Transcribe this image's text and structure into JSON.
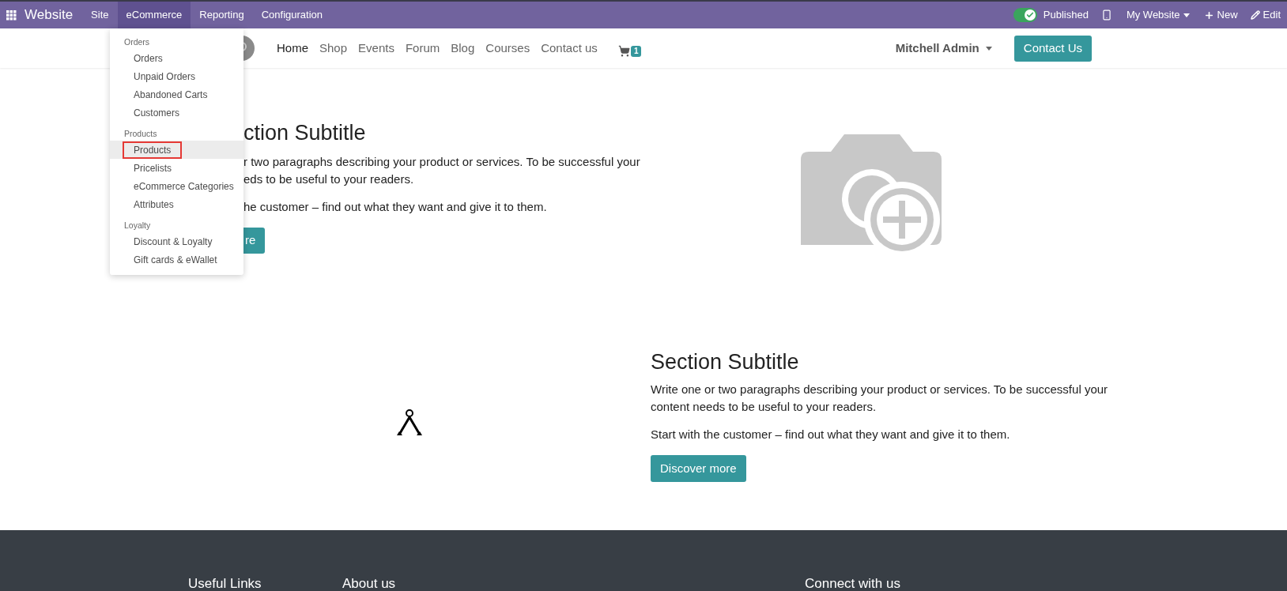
{
  "top_bar": {
    "app_name": "Website",
    "menus": [
      {
        "label": "Site",
        "selected": false
      },
      {
        "label": "eCommerce",
        "selected": true
      },
      {
        "label": "Reporting",
        "selected": false
      },
      {
        "label": "Configuration",
        "selected": false
      }
    ],
    "published": {
      "label": "Published",
      "on": true
    },
    "website_switcher": "My Website",
    "new_button": "New",
    "edit_button": "Edit"
  },
  "dropdown": {
    "groups": [
      {
        "title": "Orders",
        "items": [
          {
            "label": "Orders",
            "selected": false
          },
          {
            "label": "Unpaid Orders",
            "selected": false
          },
          {
            "label": "Abandoned Carts",
            "selected": false
          },
          {
            "label": "Customers",
            "selected": false
          }
        ]
      },
      {
        "title": "Products",
        "items": [
          {
            "label": "Products",
            "selected": true
          },
          {
            "label": "Pricelists",
            "selected": false
          },
          {
            "label": "eCommerce Categories",
            "selected": false
          },
          {
            "label": "Attributes",
            "selected": false
          }
        ]
      },
      {
        "title": "Loyalty",
        "items": [
          {
            "label": "Discount & Loyalty",
            "selected": false
          },
          {
            "label": "Gift cards & eWallet",
            "selected": false
          }
        ]
      }
    ]
  },
  "header": {
    "nav": [
      {
        "label": "Home",
        "selected": true
      },
      {
        "label": "Shop",
        "selected": false
      },
      {
        "label": "Events",
        "selected": false
      },
      {
        "label": "Forum",
        "selected": false
      },
      {
        "label": "Blog",
        "selected": false
      },
      {
        "label": "Courses",
        "selected": false
      },
      {
        "label": "Contact us",
        "selected": false
      }
    ],
    "cart_count": "1",
    "user": "Mitchell Admin",
    "cta": "Contact Us"
  },
  "section_1": {
    "title": "ction Subtitle",
    "paragraph_1_lines": [
      "r two paragraphs describing your product or services. To be successful your",
      "eds to be useful to your readers."
    ],
    "paragraph_2": "he customer – find out what they want and give it to them.",
    "button": "re"
  },
  "section_2": {
    "title": "Section Subtitle",
    "paragraph_1": "Write one or two paragraphs describing your product or services. To be successful your content needs to be useful to your readers.",
    "paragraph_2": "Start with the customer – find out what they want and give it to them.",
    "button": "Discover more"
  },
  "footer": {
    "columns": [
      "Useful Links",
      "About us",
      "Connect with us"
    ]
  }
}
